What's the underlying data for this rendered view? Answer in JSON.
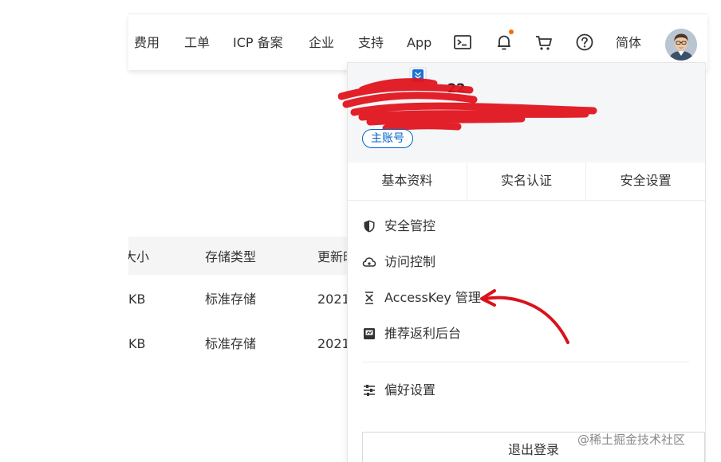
{
  "nav": {
    "items": [
      "费用",
      "工单",
      "ICP 备案",
      "企业",
      "支持",
      "App"
    ],
    "language": "简体",
    "icons": [
      "terminal-icon",
      "bell-icon",
      "cart-icon",
      "help-icon",
      "avatar"
    ],
    "bell_dot_color": "#ff6a00"
  },
  "table": {
    "headers": [
      "大小",
      "存储类型",
      "更新时间"
    ],
    "rows": [
      [
        "KB",
        "标准存储",
        "2021"
      ],
      [
        "KB",
        "标准存储",
        "2021"
      ]
    ]
  },
  "panel": {
    "username": "22",
    "badge": "主账号",
    "tabs": [
      "基本资料",
      "实名认证",
      "安全设置"
    ],
    "menu": [
      {
        "icon": "shield-icon",
        "label": "安全管控"
      },
      {
        "icon": "cloud-icon",
        "label": "访问控制"
      },
      {
        "icon": "key-icon",
        "label": "AccessKey 管理"
      },
      {
        "icon": "gift-icon",
        "label": "推荐返利后台"
      },
      {
        "icon": "sliders-icon",
        "label": "偏好设置"
      }
    ],
    "logout": "退出登录"
  },
  "annotations": {
    "scribble_color": "#e0141e",
    "arrow_color": "#d9131c"
  },
  "watermark": "@稀土掘金技术社区",
  "colors": {
    "accent": "#0064c8",
    "panel_head_bg": "#f4f6f8",
    "table_header_bg": "#f5f5f5"
  }
}
